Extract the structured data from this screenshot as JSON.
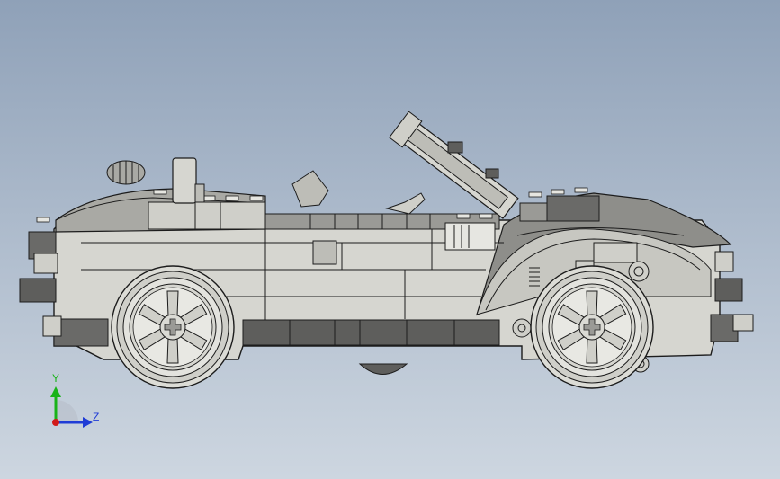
{
  "scene": {
    "object": "lego-convertible-car-model",
    "view": "side",
    "background": {
      "top": "#8fa1b8",
      "bottom": "#cdd6e0"
    },
    "model_color": "#d9d9d4",
    "dark_color": "#5e5e5c",
    "outline_color": "#1c1c1c"
  },
  "triad": {
    "y_label": "Y",
    "z_label": "Z",
    "y_color": "#19b319",
    "z_color": "#1f3cd6",
    "origin_color": "#d11a1a"
  }
}
